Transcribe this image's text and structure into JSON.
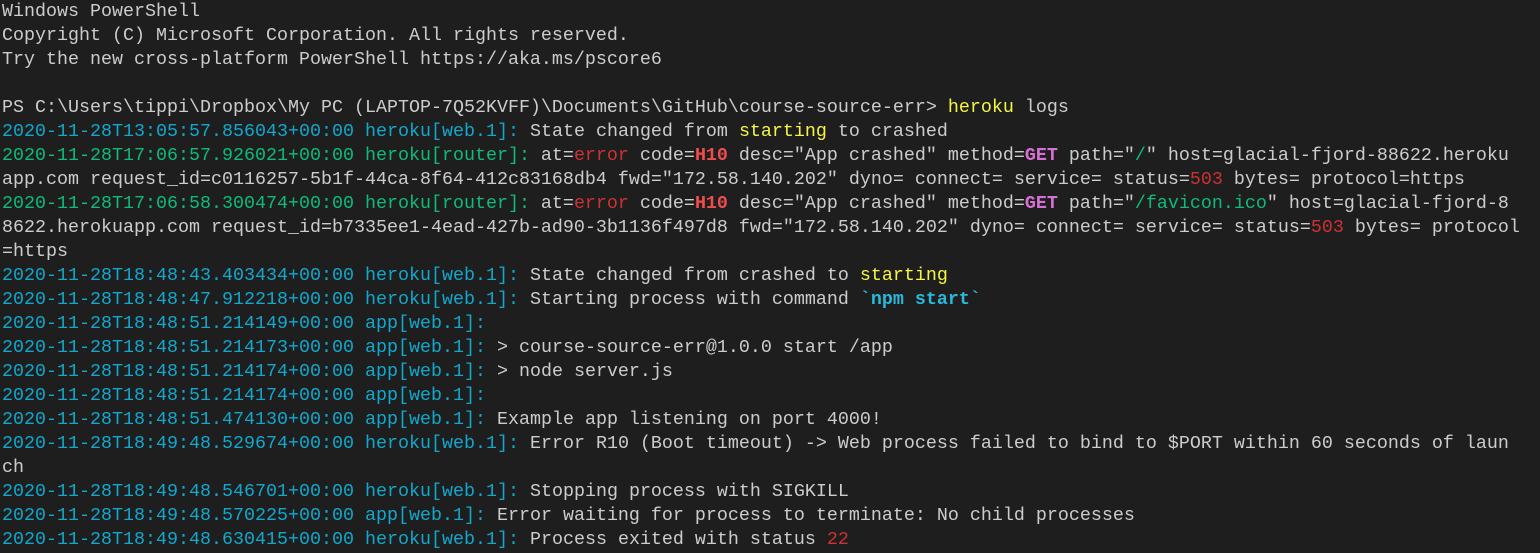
{
  "window": {
    "title": "Windows PowerShell"
  },
  "colors": {
    "background": "#1e1e1e",
    "foreground": "#cccccc",
    "cyan": "#11a8cd",
    "green": "#0dbc79",
    "yellow": "#f5f543",
    "red": "#cd3131",
    "bright_red": "#f14c4c",
    "magenta": "#d670d6"
  },
  "lines": [
    [
      [
        "",
        "Windows PowerShell"
      ]
    ],
    [
      [
        "",
        "Copyright (C) Microsoft Corporation. All rights reserved."
      ]
    ],
    [
      [
        "",
        "Try the new cross-platform PowerShell https://aka.ms/pscore6"
      ]
    ],
    [],
    [
      [
        "",
        "PS C:\\Users\\tippi\\Dropbox\\My PC (LAPTOP-7Q52KVFF)\\Documents\\GitHub\\course-source-err> "
      ],
      [
        "yellow",
        "heroku"
      ],
      [
        "",
        " logs"
      ]
    ],
    [
      [
        "cyan",
        "2020-11-28T13:05:57.856043+00:00 heroku[web.1]:"
      ],
      [
        "",
        " State changed from "
      ],
      [
        "yellow",
        "starting"
      ],
      [
        "",
        " to crashed"
      ]
    ],
    [
      [
        "green",
        "2020-11-28T17:06:57.926021+00:00 heroku[router]:"
      ],
      [
        "",
        " at="
      ],
      [
        "red",
        "error"
      ],
      [
        "",
        " code="
      ],
      [
        "bred",
        "H10"
      ],
      [
        "",
        " desc=\"App crashed\" method="
      ],
      [
        "magenta",
        "GET"
      ],
      [
        "",
        " path=\""
      ],
      [
        "green",
        "/"
      ],
      [
        "",
        "\" host=glacial-fjord-88622.herokuapp.com request_id=c0116257-5b1f-44ca-8f64-412c83168db4 fwd=\"172.58.140.202\" dyno= connect= service= status="
      ],
      [
        "red",
        "503"
      ],
      [
        "",
        " bytes= protocol=https"
      ]
    ],
    [
      [
        "green",
        "2020-11-28T17:06:58.300474+00:00 heroku[router]:"
      ],
      [
        "",
        " at="
      ],
      [
        "red",
        "error"
      ],
      [
        "",
        " code="
      ],
      [
        "bred",
        "H10"
      ],
      [
        "",
        " desc=\"App crashed\" method="
      ],
      [
        "magenta",
        "GET"
      ],
      [
        "",
        " path=\""
      ],
      [
        "green",
        "/favicon.ico"
      ],
      [
        "",
        "\" host=glacial-fjord-88622.herokuapp.com request_id=b7335ee1-4ead-427b-ad90-3b1136f497d8 fwd=\"172.58.140.202\" dyno= connect= service= status="
      ],
      [
        "red",
        "503"
      ],
      [
        "",
        " bytes= protocol=https"
      ]
    ],
    [
      [
        "cyan",
        "2020-11-28T18:48:43.403434+00:00 heroku[web.1]:"
      ],
      [
        "",
        " State changed from crashed to "
      ],
      [
        "yellow",
        "starting"
      ]
    ],
    [
      [
        "cyan",
        "2020-11-28T18:48:47.912218+00:00 heroku[web.1]:"
      ],
      [
        "",
        " Starting process with command "
      ],
      [
        "bcyan",
        "`npm start`"
      ]
    ],
    [
      [
        "cyan",
        "2020-11-28T18:48:51.214149+00:00 app[web.1]:"
      ]
    ],
    [
      [
        "cyan",
        "2020-11-28T18:48:51.214173+00:00 app[web.1]:"
      ],
      [
        "",
        " > course-source-err@1.0.0 start /app"
      ]
    ],
    [
      [
        "cyan",
        "2020-11-28T18:48:51.214174+00:00 app[web.1]:"
      ],
      [
        "",
        " > node server.js"
      ]
    ],
    [
      [
        "cyan",
        "2020-11-28T18:48:51.214174+00:00 app[web.1]:"
      ]
    ],
    [
      [
        "cyan",
        "2020-11-28T18:48:51.474130+00:00 app[web.1]:"
      ],
      [
        "",
        " Example app listening on port 4000!"
      ]
    ],
    [
      [
        "cyan",
        "2020-11-28T18:49:48.529674+00:00 heroku[web.1]:"
      ],
      [
        "",
        " Error R10 (Boot timeout) -> Web process failed to bind to $PORT within 60 seconds of launch"
      ]
    ],
    [
      [
        "cyan",
        "2020-11-28T18:49:48.546701+00:00 heroku[web.1]:"
      ],
      [
        "",
        " Stopping process with SIGKILL"
      ]
    ],
    [
      [
        "cyan",
        "2020-11-28T18:49:48.570225+00:00 app[web.1]:"
      ],
      [
        "",
        " Error waiting for process to terminate: No child processes"
      ]
    ],
    [
      [
        "cyan",
        "2020-11-28T18:49:48.630415+00:00 heroku[web.1]:"
      ],
      [
        "",
        " Process exited with status "
      ],
      [
        "red",
        "22"
      ]
    ]
  ]
}
